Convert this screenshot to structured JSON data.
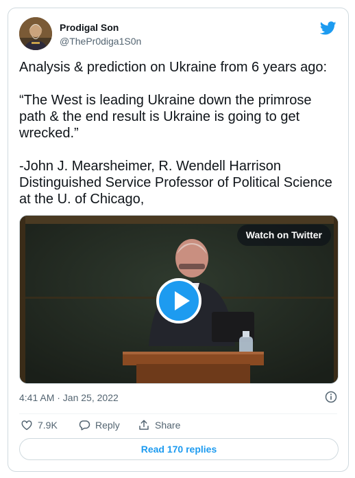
{
  "author": {
    "display_name": "Prodigal Son",
    "handle": "@ThePr0diga1S0n",
    "avatar_icon": "portrait-avatar"
  },
  "brand": {
    "icon": "twitter-bird-icon",
    "color": "#1d9bf0"
  },
  "tweet": {
    "paragraphs": [
      "Analysis & prediction on Ukraine from 6 years ago:",
      "“The West is leading Ukraine down the primrose path & the end result is Ukraine is going to get wrecked.”",
      "-John J. Mearsheimer, R. Wendell Harrison Distinguished Service Professor of Political Science at the U.  of Chicago,"
    ]
  },
  "media": {
    "type": "video",
    "watch_label": "Watch on Twitter",
    "play_icon": "play-icon"
  },
  "meta": {
    "timestamp": "4:41 AM · Jan 25, 2022",
    "info_icon": "info-icon"
  },
  "actions": {
    "like_count": "7.9K",
    "reply_label": "Reply",
    "share_label": "Share"
  },
  "replies_button": "Read 170 replies",
  "colors": {
    "accent": "#1d9bf0",
    "text_primary": "#0f1419",
    "text_secondary": "#536471",
    "border": "#cfd9de"
  }
}
